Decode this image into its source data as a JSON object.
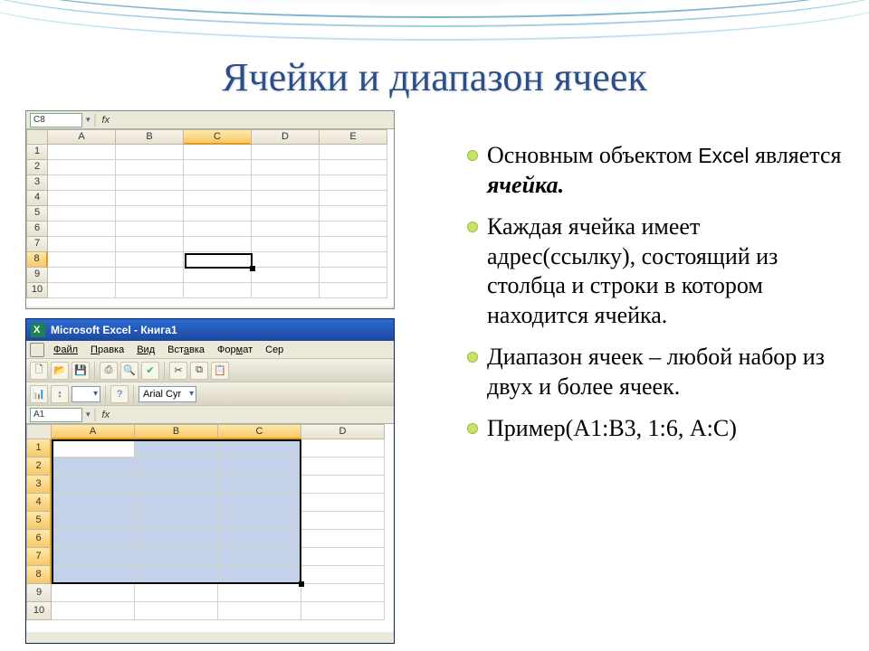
{
  "title": "Ячейки и диапазон ячеек",
  "bullets": {
    "b1_pre": "Основным объектом ",
    "b1_excel": "Excel",
    "b1_mid": " является ",
    "b1_em": "ячейка.",
    "b2": "Каждая ячейка имеет адрес(ссылку), состоящий из столбца и строки в котором находится ячейка.",
    "b3": "Диапазон ячеек – любой набор из двух и более ячеек.",
    "b4": "Пример(А1:В3, 1:6, А:С)"
  },
  "frag1": {
    "namebox": "C8",
    "fx": "fx",
    "cols": [
      "A",
      "B",
      "C",
      "D",
      "E"
    ],
    "rows": [
      "1",
      "2",
      "3",
      "4",
      "5",
      "6",
      "7",
      "8",
      "9",
      "10"
    ],
    "selected_col": "C",
    "selected_row": "8"
  },
  "frag2": {
    "window_title": "Microsoft Excel - Книга1",
    "menus": [
      "Файл",
      "Правка",
      "Вид",
      "Вставка",
      "Формат",
      "Сер"
    ],
    "font": "Arial Cyr",
    "namebox": "A1",
    "fx": "fx",
    "cols": [
      "A",
      "B",
      "C",
      "D"
    ],
    "rows": [
      "1",
      "2",
      "3",
      "4",
      "5",
      "6",
      "7",
      "8",
      "9",
      "10"
    ],
    "selected_cols": [
      "A",
      "B",
      "C"
    ],
    "selected_rows": [
      "1",
      "2",
      "3",
      "4",
      "5",
      "6",
      "7",
      "8"
    ],
    "selection": "A1:C8"
  }
}
